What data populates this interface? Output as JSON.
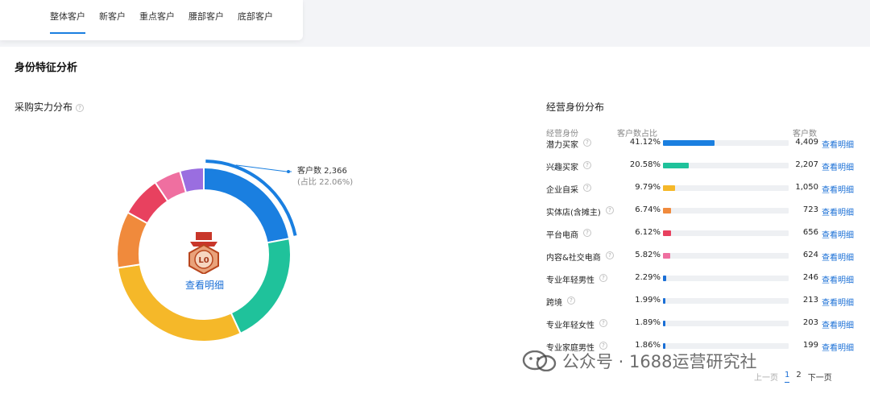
{
  "tabs": [
    "整体客户",
    "新客户",
    "重点客户",
    "腰部客户",
    "底部客户"
  ],
  "section_title": "身份特征分析",
  "left_title": "采购实力分布",
  "right_title": "经营身份分布",
  "callout": {
    "line1": "客户数 2,366",
    "line2": "(占比 22.06%)"
  },
  "center_link": "查看明细",
  "medal_text": "L0",
  "table_headers": {
    "name": "经营身份",
    "pct": "客户数占比",
    "cnt": "客户数"
  },
  "rows": [
    {
      "name": "潜力买家",
      "pct": "41.12%",
      "value": 41.12,
      "count": "4,409",
      "link": "查看明细",
      "color": "#1a7fe0"
    },
    {
      "name": "兴趣买家",
      "pct": "20.58%",
      "value": 20.58,
      "count": "2,207",
      "link": "查看明细",
      "color": "#1fc29b"
    },
    {
      "name": "企业自采",
      "pct": "9.79%",
      "value": 9.79,
      "count": "1,050",
      "link": "查看明细",
      "color": "#f5b829"
    },
    {
      "name": "实体店(含摊主)",
      "pct": "6.74%",
      "value": 6.74,
      "count": "723",
      "link": "查看明细",
      "color": "#f08a3c"
    },
    {
      "name": "平台电商",
      "pct": "6.12%",
      "value": 6.12,
      "count": "656",
      "link": "查看明细",
      "color": "#e8415f"
    },
    {
      "name": "内容&社交电商",
      "pct": "5.82%",
      "value": 5.82,
      "count": "624",
      "link": "查看明细",
      "color": "#ef6fa0"
    },
    {
      "name": "专业年轻男性",
      "pct": "2.29%",
      "value": 2.29,
      "count": "246",
      "link": "查看明细",
      "color": "#1a6fd6"
    },
    {
      "name": "跨境",
      "pct": "1.99%",
      "value": 1.99,
      "count": "213",
      "link": "查看明细",
      "color": "#1a6fd6"
    },
    {
      "name": "专业年轻女性",
      "pct": "1.89%",
      "value": 1.89,
      "count": "203",
      "link": "查看明细",
      "color": "#1a6fd6"
    },
    {
      "name": "专业家庭男性",
      "pct": "1.86%",
      "value": 1.86,
      "count": "199",
      "link": "查看明细",
      "color": "#1a6fd6"
    }
  ],
  "donut": [
    {
      "value": 22.06,
      "color": "#1a7fe0"
    },
    {
      "value": 21.0,
      "color": "#1fc29b"
    },
    {
      "value": 29.5,
      "color": "#f5b829"
    },
    {
      "value": 10.5,
      "color": "#f08a3c"
    },
    {
      "value": 7.5,
      "color": "#e8415f"
    },
    {
      "value": 5.0,
      "color": "#ef6fa0"
    },
    {
      "value": 4.44,
      "color": "#9a6ee0"
    }
  ],
  "watermark": "公众号 · 1688运营研究社",
  "pager": {
    "prev": "上一页",
    "p1": "1",
    "p2": "2",
    "next": "下一页"
  }
}
